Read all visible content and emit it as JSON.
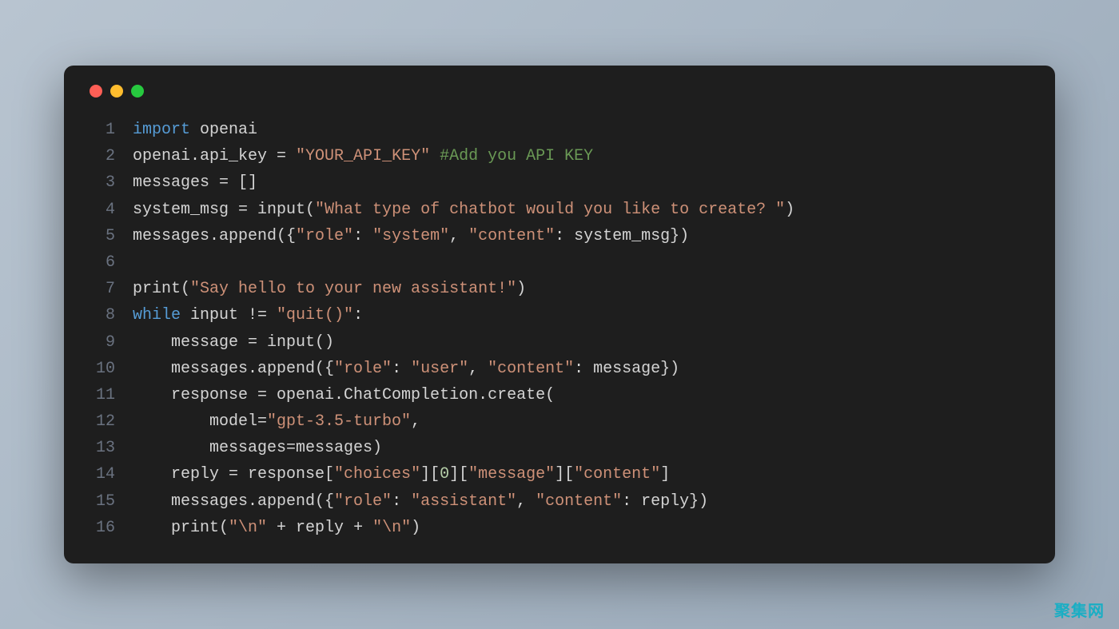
{
  "window": {
    "controls": [
      "close",
      "minimize",
      "maximize"
    ]
  },
  "code": {
    "lines": [
      {
        "num": "1",
        "tokens": [
          {
            "t": "import",
            "c": "keyword"
          },
          {
            "t": " openai",
            "c": "default"
          }
        ]
      },
      {
        "num": "2",
        "tokens": [
          {
            "t": "openai.api_key = ",
            "c": "default"
          },
          {
            "t": "\"YOUR_API_KEY\"",
            "c": "string"
          },
          {
            "t": " ",
            "c": "default"
          },
          {
            "t": "#Add you API KEY",
            "c": "comment"
          }
        ]
      },
      {
        "num": "3",
        "tokens": [
          {
            "t": "messages = []",
            "c": "default"
          }
        ]
      },
      {
        "num": "4",
        "tokens": [
          {
            "t": "system_msg = input(",
            "c": "default"
          },
          {
            "t": "\"What type of chatbot would you like to create? \"",
            "c": "string"
          },
          {
            "t": ")",
            "c": "default"
          }
        ]
      },
      {
        "num": "5",
        "tokens": [
          {
            "t": "messages.append({",
            "c": "default"
          },
          {
            "t": "\"role\"",
            "c": "string"
          },
          {
            "t": ": ",
            "c": "default"
          },
          {
            "t": "\"system\"",
            "c": "string"
          },
          {
            "t": ", ",
            "c": "default"
          },
          {
            "t": "\"content\"",
            "c": "string"
          },
          {
            "t": ": system_msg})",
            "c": "default"
          }
        ]
      },
      {
        "num": "6",
        "tokens": []
      },
      {
        "num": "7",
        "tokens": [
          {
            "t": "print(",
            "c": "default"
          },
          {
            "t": "\"Say hello to your new assistant!\"",
            "c": "string"
          },
          {
            "t": ")",
            "c": "default"
          }
        ]
      },
      {
        "num": "8",
        "tokens": [
          {
            "t": "while",
            "c": "keyword"
          },
          {
            "t": " input != ",
            "c": "default"
          },
          {
            "t": "\"quit()\"",
            "c": "string"
          },
          {
            "t": ":",
            "c": "default"
          }
        ]
      },
      {
        "num": "9",
        "tokens": [
          {
            "t": "    message = input()",
            "c": "default"
          }
        ]
      },
      {
        "num": "10",
        "tokens": [
          {
            "t": "    messages.append({",
            "c": "default"
          },
          {
            "t": "\"role\"",
            "c": "string"
          },
          {
            "t": ": ",
            "c": "default"
          },
          {
            "t": "\"user\"",
            "c": "string"
          },
          {
            "t": ", ",
            "c": "default"
          },
          {
            "t": "\"content\"",
            "c": "string"
          },
          {
            "t": ": message})",
            "c": "default"
          }
        ]
      },
      {
        "num": "11",
        "tokens": [
          {
            "t": "    response = openai.ChatCompletion.create(",
            "c": "default"
          }
        ]
      },
      {
        "num": "12",
        "tokens": [
          {
            "t": "        model=",
            "c": "default"
          },
          {
            "t": "\"gpt-3.5-turbo\"",
            "c": "string"
          },
          {
            "t": ",",
            "c": "default"
          }
        ]
      },
      {
        "num": "13",
        "tokens": [
          {
            "t": "        messages=messages)",
            "c": "default"
          }
        ]
      },
      {
        "num": "14",
        "tokens": [
          {
            "t": "    reply = response[",
            "c": "default"
          },
          {
            "t": "\"choices\"",
            "c": "string"
          },
          {
            "t": "][",
            "c": "default"
          },
          {
            "t": "0",
            "c": "number"
          },
          {
            "t": "][",
            "c": "default"
          },
          {
            "t": "\"message\"",
            "c": "string"
          },
          {
            "t": "][",
            "c": "default"
          },
          {
            "t": "\"content\"",
            "c": "string"
          },
          {
            "t": "]",
            "c": "default"
          }
        ]
      },
      {
        "num": "15",
        "tokens": [
          {
            "t": "    messages.append({",
            "c": "default"
          },
          {
            "t": "\"role\"",
            "c": "string"
          },
          {
            "t": ": ",
            "c": "default"
          },
          {
            "t": "\"assistant\"",
            "c": "string"
          },
          {
            "t": ", ",
            "c": "default"
          },
          {
            "t": "\"content\"",
            "c": "string"
          },
          {
            "t": ": reply})",
            "c": "default"
          }
        ]
      },
      {
        "num": "16",
        "tokens": [
          {
            "t": "    print(",
            "c": "default"
          },
          {
            "t": "\"\\n\"",
            "c": "string"
          },
          {
            "t": " + reply + ",
            "c": "default"
          },
          {
            "t": "\"\\n\"",
            "c": "string"
          },
          {
            "t": ")",
            "c": "default"
          }
        ]
      }
    ]
  },
  "watermark": "聚集网"
}
